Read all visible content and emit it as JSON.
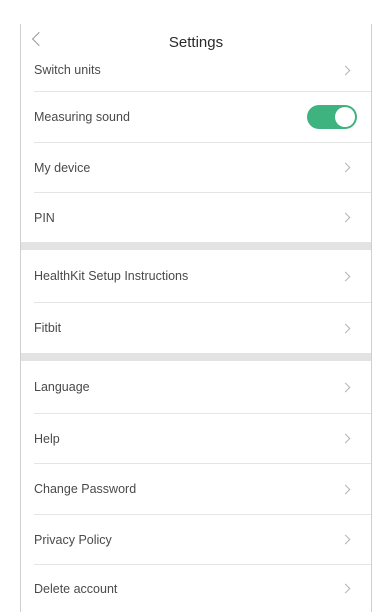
{
  "header": {
    "title": "Settings"
  },
  "rows": [
    {
      "label": "Switch units"
    },
    {
      "label": "Measuring sound",
      "toggle_on": true
    },
    {
      "label": "My device"
    },
    {
      "label": "PIN"
    },
    {
      "label": "HealthKit Setup Instructions"
    },
    {
      "label": "Fitbit"
    },
    {
      "label": "Language"
    },
    {
      "label": "Help"
    },
    {
      "label": "Change Password"
    },
    {
      "label": "Privacy Policy"
    },
    {
      "label": "Delete account"
    }
  ],
  "colors": {
    "toggle_on": "#3fb37f",
    "section_gap": "#e3e3e3"
  }
}
